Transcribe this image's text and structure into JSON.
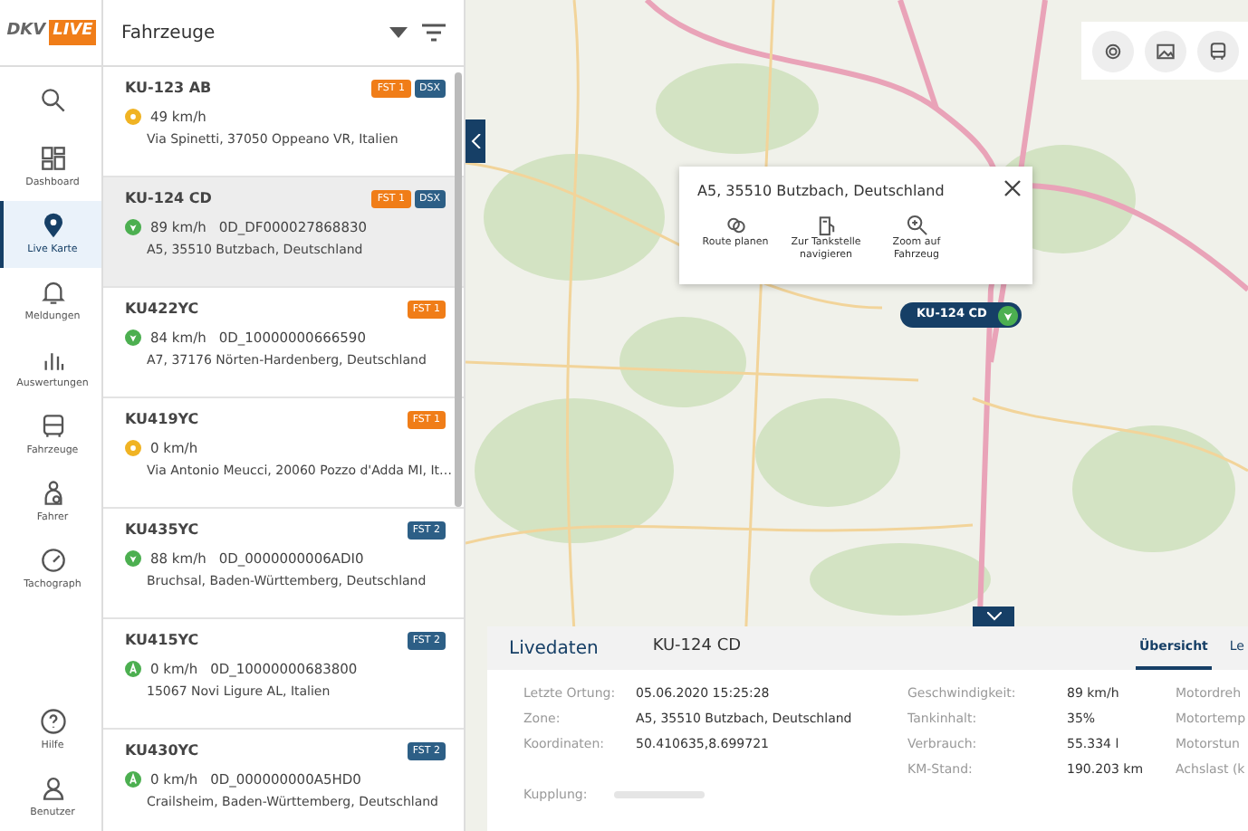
{
  "brand": {
    "left": "DKV",
    "right": "LIVE"
  },
  "nav": [
    {
      "label": "Dashboard",
      "selected": false
    },
    {
      "label": "Live Karte",
      "selected": true
    },
    {
      "label": "Meldungen",
      "selected": false
    },
    {
      "label": "Auswertungen",
      "selected": false
    },
    {
      "label": "Fahrzeuge",
      "selected": false
    },
    {
      "label": "Fahrer",
      "selected": false
    },
    {
      "label": "Tachograph",
      "selected": false
    }
  ],
  "nav_bottom": [
    {
      "label": "Hilfe"
    },
    {
      "label": "Benutzer"
    }
  ],
  "list_title": "Fahrzeuge",
  "vehicles": [
    {
      "name": "KU-123 AB",
      "selected": false,
      "kind": "idle",
      "color": "#f0b323",
      "speed": "49 km/h",
      "address": "Via Spinetti, 37050 Oppeano VR, Italien",
      "tags": [
        {
          "text": "FST 1",
          "color": "#f07d18"
        },
        {
          "text": "DSX",
          "color": "#2d5f86"
        }
      ]
    },
    {
      "name": "KU-124 CD",
      "selected": true,
      "kind": "driving",
      "color": "#4caf50",
      "speed": "89 km/h",
      "id": "0D_DF000027868830",
      "address": "A5, 35510 Butzbach, Deutschland",
      "tags": [
        {
          "text": "FST 1",
          "color": "#f07d18"
        },
        {
          "text": "DSX",
          "color": "#2d5f86"
        }
      ]
    },
    {
      "name": "KU422YC",
      "selected": false,
      "kind": "driving",
      "color": "#4caf50",
      "speed": "84 km/h",
      "id": "0D_10000000666590",
      "address": "A7, 37176 Nörten-Hardenberg, Deutschland",
      "tags": [
        {
          "text": "FST 1",
          "color": "#f07d18"
        }
      ]
    },
    {
      "name": "KU419YC",
      "selected": false,
      "kind": "idle",
      "color": "#f0b323",
      "speed": "0 km/h",
      "address": "Via Antonio Meucci, 20060 Pozzo d'Adda MI, It…",
      "tags": [
        {
          "text": "FST 1",
          "color": "#f07d18"
        }
      ]
    },
    {
      "name": "KU435YC",
      "selected": false,
      "kind": "driving",
      "color": "#4caf50",
      "speed": "88 km/h",
      "id": "0D_0000000006ADI0",
      "address": "Bruchsal, Baden-Württemberg, Deutschland",
      "tags": [
        {
          "text": "FST 2",
          "color": "#2d5f86"
        }
      ]
    },
    {
      "name": "KU415YC",
      "selected": false,
      "kind": "parked",
      "color": "#4caf50",
      "speed": "0 km/h",
      "id": "0D_10000000683800",
      "address": "15067 Novi Ligure AL, Italien",
      "tags": [
        {
          "text": "FST 2",
          "color": "#2d5f86"
        }
      ]
    },
    {
      "name": "KU430YC",
      "selected": false,
      "kind": "parked",
      "color": "#4caf50",
      "speed": "0 km/h",
      "id": "0D_000000000A5HD0",
      "address": "Crailsheim, Baden-Württemberg, Deutschland",
      "tags": [
        {
          "text": "FST 2",
          "color": "#2d5f86"
        }
      ]
    }
  ],
  "popup": {
    "address": "A5, 35510 Butzbach, Deutschland",
    "actions": [
      {
        "label": "Route planen"
      },
      {
        "label": "Zur Tankstelle navigieren"
      },
      {
        "label": "Zoom auf Fahrzeug"
      }
    ]
  },
  "marker": {
    "label": "KU-124 CD"
  },
  "livedaten": {
    "title": "Livedaten",
    "vehicle": "KU-124 CD",
    "tabs": [
      {
        "label": "Übersicht",
        "selected": true
      },
      {
        "label": "Le",
        "selected": false
      }
    ],
    "col1": [
      {
        "label": "Letzte Ortung:",
        "value": "05.06.2020 15:25:28"
      },
      {
        "label": "Zone:",
        "value": "A5, 35510 Butzbach, Deutschland"
      },
      {
        "label": "Koordinaten:",
        "value": "50.410635,8.699721"
      }
    ],
    "col2": [
      {
        "label": "Geschwindigkeit:",
        "value": "89 km/h"
      },
      {
        "label": "Tankinhalt:",
        "value": "35%"
      },
      {
        "label": "Verbrauch:",
        "value": "55.334 l"
      },
      {
        "label": "KM-Stand:",
        "value": "190.203 km"
      }
    ],
    "col3": [
      "Motordreh",
      "Motortemp",
      "Motorstun",
      "Achslast (k"
    ],
    "kupplung": {
      "label": "Kupplung:"
    }
  }
}
